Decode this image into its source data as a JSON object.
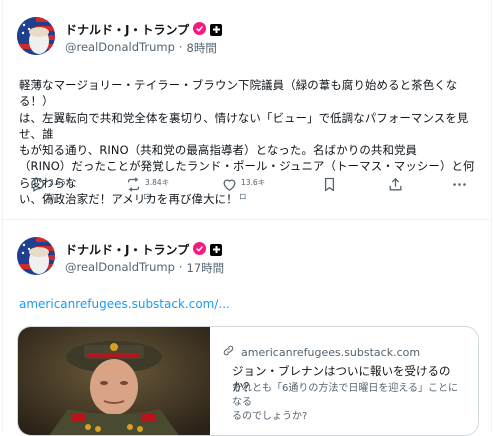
{
  "posts": [
    {
      "author": {
        "name": "ドナルド・J・トランプ",
        "handle": "@realDonaldTrump",
        "time": "8時間"
      },
      "text": [
        "軽薄なマージョリー・テイラー・ブラウン下院議員（緑の葦も腐り始めると茶色くなる！）",
        "は、左翼転向で共和党全体を裏切り、情けない「ビュー」で低調なパフォーマンスを見せ、誰",
        "もが知る通り、RINO（共和党の最高指導者）となった。名ばかりの共和党員",
        "（RINO）だったことが発覚したランド・ポール・ジュニア（トーマス・マッシー）と何ら変わらな",
        "い、偽政治家だ！アメリカを再び偉大に！"
      ],
      "actions": {
        "replies": "2.55キ",
        "reposts": "3.84キ",
        "likes": "13.6キ",
        "reply_sub": "ロ",
        "repost_sub": "ロ",
        "like_sub": "ロ"
      }
    },
    {
      "author": {
        "name": "ドナルド・J・トランプ",
        "handle": "@realDonaldTrump",
        "time": "17時間"
      },
      "link": "americanrefugees.substack.com/...",
      "card": {
        "domain": "americanrefugees.substack.com",
        "title": "ジョン・ブレナンはついに報いを受けるのか？",
        "description": [
          "それとも「6通りの方法で日曜日を迎える」ことになる",
          "るのでしょうか?"
        ]
      }
    }
  ],
  "colors": {
    "verified": "#f91880",
    "link": "#1d9bf0",
    "muted": "#536471"
  },
  "icons": [
    "verified-badge-icon",
    "government-badge-icon",
    "reply-icon",
    "repost-icon",
    "like-icon",
    "bookmark-icon",
    "share-icon",
    "more-icon",
    "link-icon"
  ]
}
